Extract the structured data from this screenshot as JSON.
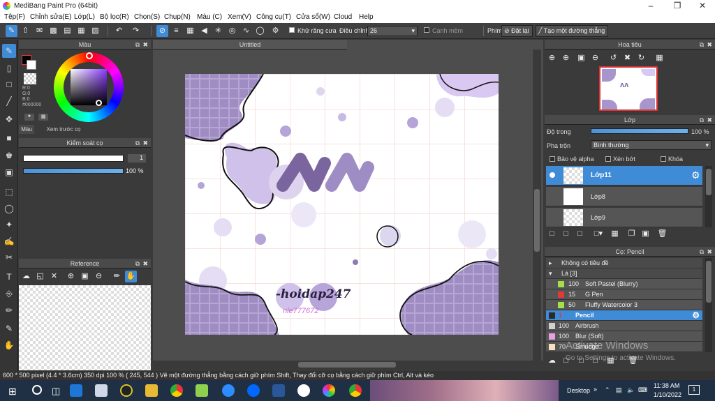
{
  "window": {
    "title": "MediBang Paint Pro (64bit)"
  },
  "menu": [
    "Tệp(F)",
    "Chỉnh sửa(E)",
    "Lớp(L)",
    "Bộ lọc(R)",
    "Chọn(S)",
    "Chụp(N)",
    "Màu (C)",
    "Xem(V)",
    "Công cụ(T)",
    "Cửa sổ(W)",
    "Cloud",
    "Help"
  ],
  "toolbar": {
    "antialias_label": "Khử răng cưa",
    "correction_label": "Điều chỉnh",
    "correction_value": "26",
    "edge_label": "Cạnh mềm",
    "pen_label": "Phím",
    "reset_label": "Đặt lại",
    "straight_label": "Tạo một đường thẳng"
  },
  "color_panel": {
    "title": "Màu",
    "r": "R:0",
    "g": "G:0",
    "b": "B:0",
    "hex": "#000000",
    "tab_color": "Màu",
    "tab_preview": "Xem trước cọ",
    "primary_color": "#000000"
  },
  "brush_control": {
    "title": "Kiểm soát cọ",
    "size": "1",
    "opacity": "100 %"
  },
  "reference": {
    "title": "Reference"
  },
  "canvas": {
    "tab": "Untitled",
    "watermark_text": "-hoidap247",
    "sub_text": "nle777672"
  },
  "navigator": {
    "title": "Hoa tiêu"
  },
  "layers": {
    "title": "Lớp",
    "opacity_label": "Độ trong",
    "opacity_value": "100 %",
    "blend_label": "Pha trộn",
    "blend_value": "Bình thường",
    "protect_alpha": "Bảo vệ alpha",
    "clipping": "Xén bớt",
    "lock": "Khóa",
    "items": [
      {
        "name": "Lớp11",
        "selected": true
      },
      {
        "name": "Lớp8",
        "selected": false
      },
      {
        "name": "Lớp9",
        "selected": false
      }
    ]
  },
  "brushes": {
    "title": "Cọ: Pencil",
    "group_untitled": "Không có tiêu đề",
    "group_leaf": "Lá [3]",
    "items": [
      {
        "size": "100",
        "name": "Soft Pastel (Blurry)",
        "color": "#a4e04a"
      },
      {
        "size": "15",
        "name": "G Pen",
        "color": "#e03a3a"
      },
      {
        "size": "50",
        "name": "Fluffy Watercolor 3",
        "color": "#a4e04a"
      },
      {
        "size": "1",
        "name": "Pencil",
        "color": "#2a2a2a"
      },
      {
        "size": "100",
        "name": "Airbrush",
        "color": "#d0d0d0"
      },
      {
        "size": "100",
        "name": "Blur (Soft)",
        "color": "#e8a0e0"
      },
      {
        "size": "70",
        "name": "Smudge",
        "color": "#f8e0c0"
      }
    ],
    "activation_overlay": "Activate Windows",
    "activation_sub": "Go to Settings to activate Windows."
  },
  "status": {
    "text": "600 * 500 pixel   (4.4 * 3.6cm)   350 dpi   100 %   ( 245, 544 )   Vẽ một đường thẳng bằng cách giữ phím Shift, Thay đổi cỡ cọ bằng cách giữ phím Ctrl, Alt và kéo"
  },
  "taskbar": {
    "desktop_label": "Desktop",
    "time": "11:38 AM",
    "date": "1/10/2022",
    "notifications": "1"
  }
}
